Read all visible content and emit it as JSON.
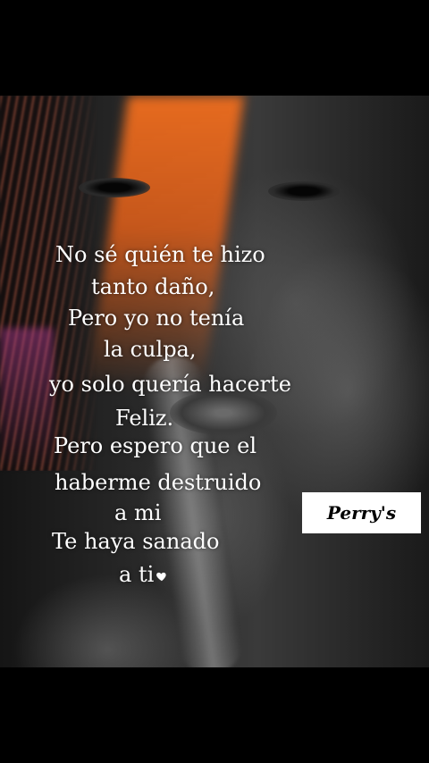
{
  "poem": {
    "lines": [
      "No sé quién te hizo",
      "tanto daño,",
      "Pero yo no tenía",
      "la culpa,",
      "yo solo quería hacerte",
      "Feliz.",
      "Pero espero que el",
      "haberme destruido",
      "a mi",
      "Te haya sanado",
      "a ti"
    ],
    "ending_icon": "heart-icon"
  },
  "badge": {
    "text": "Perry's"
  },
  "colors": {
    "text": "#ffffff",
    "accent": "#e8681e",
    "background": "#000000"
  }
}
